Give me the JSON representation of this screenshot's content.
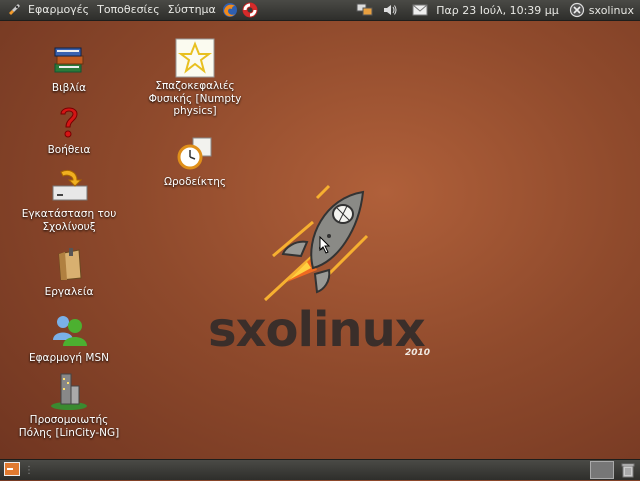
{
  "top_panel": {
    "menus": [
      "Εφαρμογές",
      "Τοποθεσίες",
      "Σύστημα"
    ],
    "clock": "Παρ 23 Ιούλ, 10:39 μμ",
    "user": "sxolinux"
  },
  "desktop_icons": [
    {
      "label": "Βιβλία",
      "icon": "books-icon"
    },
    {
      "label": "Βοήθεια",
      "icon": "help-icon"
    },
    {
      "label": "Εγκατάσταση του Σχολίνουξ",
      "icon": "install-icon"
    },
    {
      "label": "Εργαλεία",
      "icon": "tools-bag-icon"
    },
    {
      "label": "Εφαρμογή MSN",
      "icon": "msn-icon"
    },
    {
      "label": "Προσομοιωτής Πόλης [LinCity-NG]",
      "icon": "lincity-icon"
    },
    {
      "label": "Σπαζοκεφαλιές Φυσικής [Numpty physics]",
      "icon": "star-icon"
    },
    {
      "label": "Ωροδείκτης",
      "icon": "timetracker-icon"
    }
  ],
  "logo": {
    "text": "sxolinux",
    "year": "2010"
  },
  "colors": {
    "panel": "#3a3a37",
    "desktop": "#8f4a2c"
  }
}
